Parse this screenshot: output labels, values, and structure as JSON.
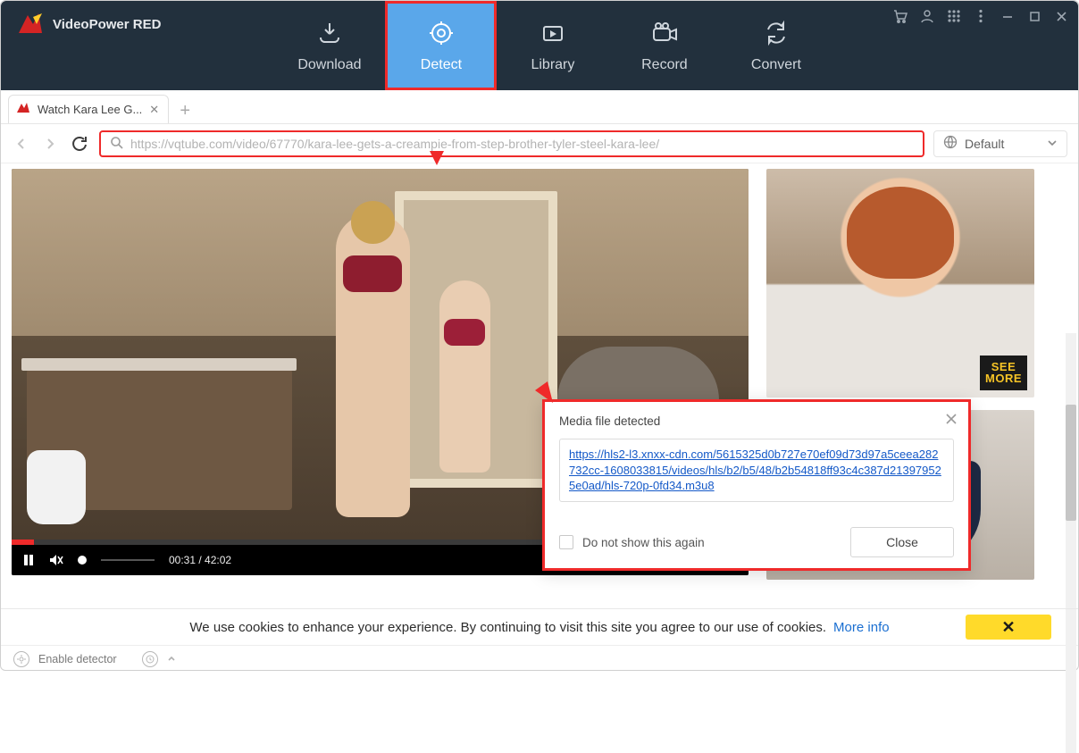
{
  "app": {
    "title": "VideoPower RED"
  },
  "nav": {
    "download": "Download",
    "detect": "Detect",
    "library": "Library",
    "record": "Record",
    "convert": "Convert"
  },
  "tab": {
    "title": "Watch Kara Lee G..."
  },
  "url": {
    "value": "https://vqtube.com/video/67770/kara-lee-gets-a-creampie-from-step-brother-tyler-steel-kara-lee/"
  },
  "region": {
    "label": "Default"
  },
  "player": {
    "time": "00:31 / 42:02"
  },
  "side": {
    "seemore_line1": "SEE",
    "seemore_line2": "MORE"
  },
  "dialog": {
    "title": "Media file detected",
    "url": "https://hls2-l3.xnxx-cdn.com/5615325d0b727e70ef09d73d97a5ceea282732cc-1608033815/videos/hls/b2/b5/48/b2b54818ff93c4c387d213979525e0ad/hls-720p-0fd34.m3u8",
    "checkbox": "Do not show this again",
    "close": "Close"
  },
  "cookies": {
    "text": "We use cookies to enhance your experience. By continuing to visit this site you agree to our use of cookies.",
    "more": "More info"
  },
  "status": {
    "enable": "Enable detector"
  }
}
